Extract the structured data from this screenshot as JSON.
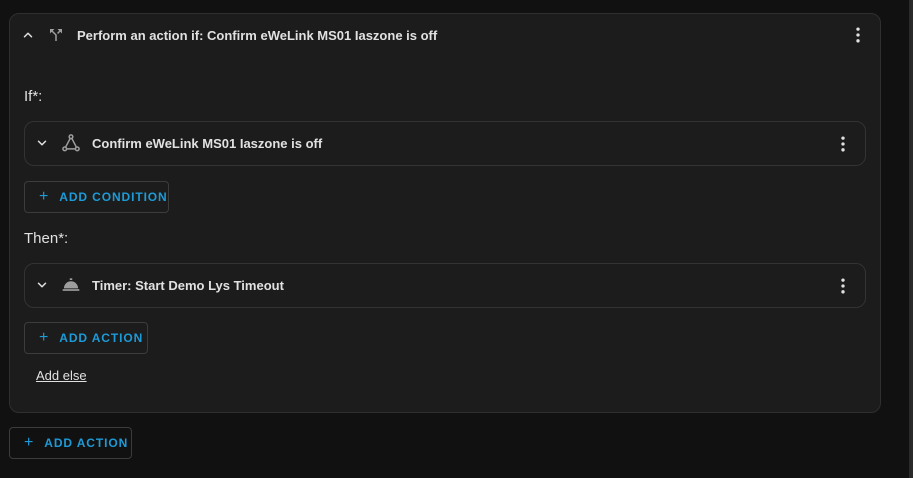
{
  "outer_block": {
    "title": "Perform an action if: Confirm eWeLink MS01 Iaszone is off",
    "collapse_icon": "chevron-up-icon",
    "type_icon": "call-split-icon",
    "menu_icon": "dots-vertical-icon"
  },
  "if_section": {
    "label": "If*:",
    "condition": {
      "title": "Confirm eWeLink MS01 Iaszone is off",
      "expand_icon": "chevron-down-icon",
      "type_icon": "device-hub-icon",
      "menu_icon": "dots-vertical-icon"
    },
    "add_button": {
      "icon": "plus-icon",
      "label": "ADD CONDITION"
    }
  },
  "then_section": {
    "label": "Then*:",
    "action": {
      "title": "Timer: Start Demo Lys Timeout",
      "expand_icon": "chevron-down-icon",
      "type_icon": "room-service-bell-icon",
      "menu_icon": "dots-vertical-icon"
    },
    "add_button": {
      "icon": "plus-icon",
      "label": "ADD ACTION"
    }
  },
  "add_else_label": "Add else",
  "bottom_add_button": {
    "icon": "plus-icon",
    "label": "ADD ACTION"
  },
  "colors": {
    "accent": "#1d9bd8",
    "background": "#111111",
    "card": "#1c1c1c",
    "text": "#e1e1e1"
  }
}
